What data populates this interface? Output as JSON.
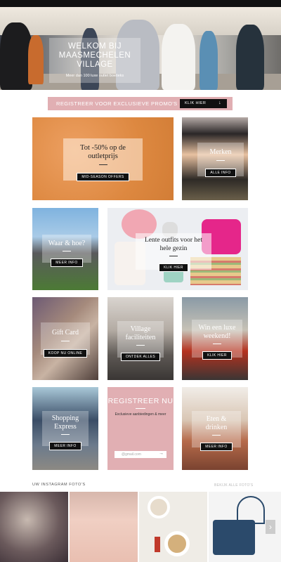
{
  "hero": {
    "title_line1": "WELKOM BIJ",
    "title_line2": "MAASMECHELEN",
    "title_line3": "VILLAGE",
    "subtitle": "Meer dan 100 luxe outlet boetieks"
  },
  "promo": {
    "label": "REGISTREER VOOR EXCLUSIEVE PROMO'S",
    "button": "KLIK HIER",
    "arrow": "↓"
  },
  "tiles": {
    "offers": {
      "title_line1": "Tot -50% op de",
      "title_line2": "outletprijs",
      "button": "MID-SEASON OFFERS"
    },
    "brands": {
      "title": "Merken",
      "button": "ALLE INFO"
    },
    "where": {
      "title": "Waar & hoe?",
      "button": "MEER INFO"
    },
    "spring": {
      "title_line1": "Lente outfits voor het",
      "title_line2": "hele gezin",
      "button": "KLIK HIER"
    },
    "giftcard": {
      "title": "Gift Card",
      "button": "KOOP NU ONLINE"
    },
    "facilities": {
      "title_line1": "Village",
      "title_line2": "faciliteiten",
      "button": "ONTDEK ALLES"
    },
    "win": {
      "title_line1": "Win een luxe",
      "title_line2": "weekend!",
      "button": "KLIK HIER"
    },
    "shopping": {
      "title_line1": "Shopping",
      "title_line2": "Express",
      "button": "MEER INFO"
    },
    "register": {
      "title": "REGISTREER NU",
      "subtitle": "Exclusieve aanbiedingen & meer",
      "placeholder": "@gmail.com",
      "arrow": "→"
    },
    "food": {
      "title_line1": "Eten &",
      "title_line2": "drinken",
      "button": "MEER INFO"
    }
  },
  "instagram": {
    "title": "UW INSTAGRAM FOTO'S",
    "link": "BEKIJK ALLE FOTO'S",
    "next": "›"
  },
  "colors": {
    "accent_pink": "#e1afb3",
    "orange": "#e08a45",
    "black": "#111111"
  }
}
